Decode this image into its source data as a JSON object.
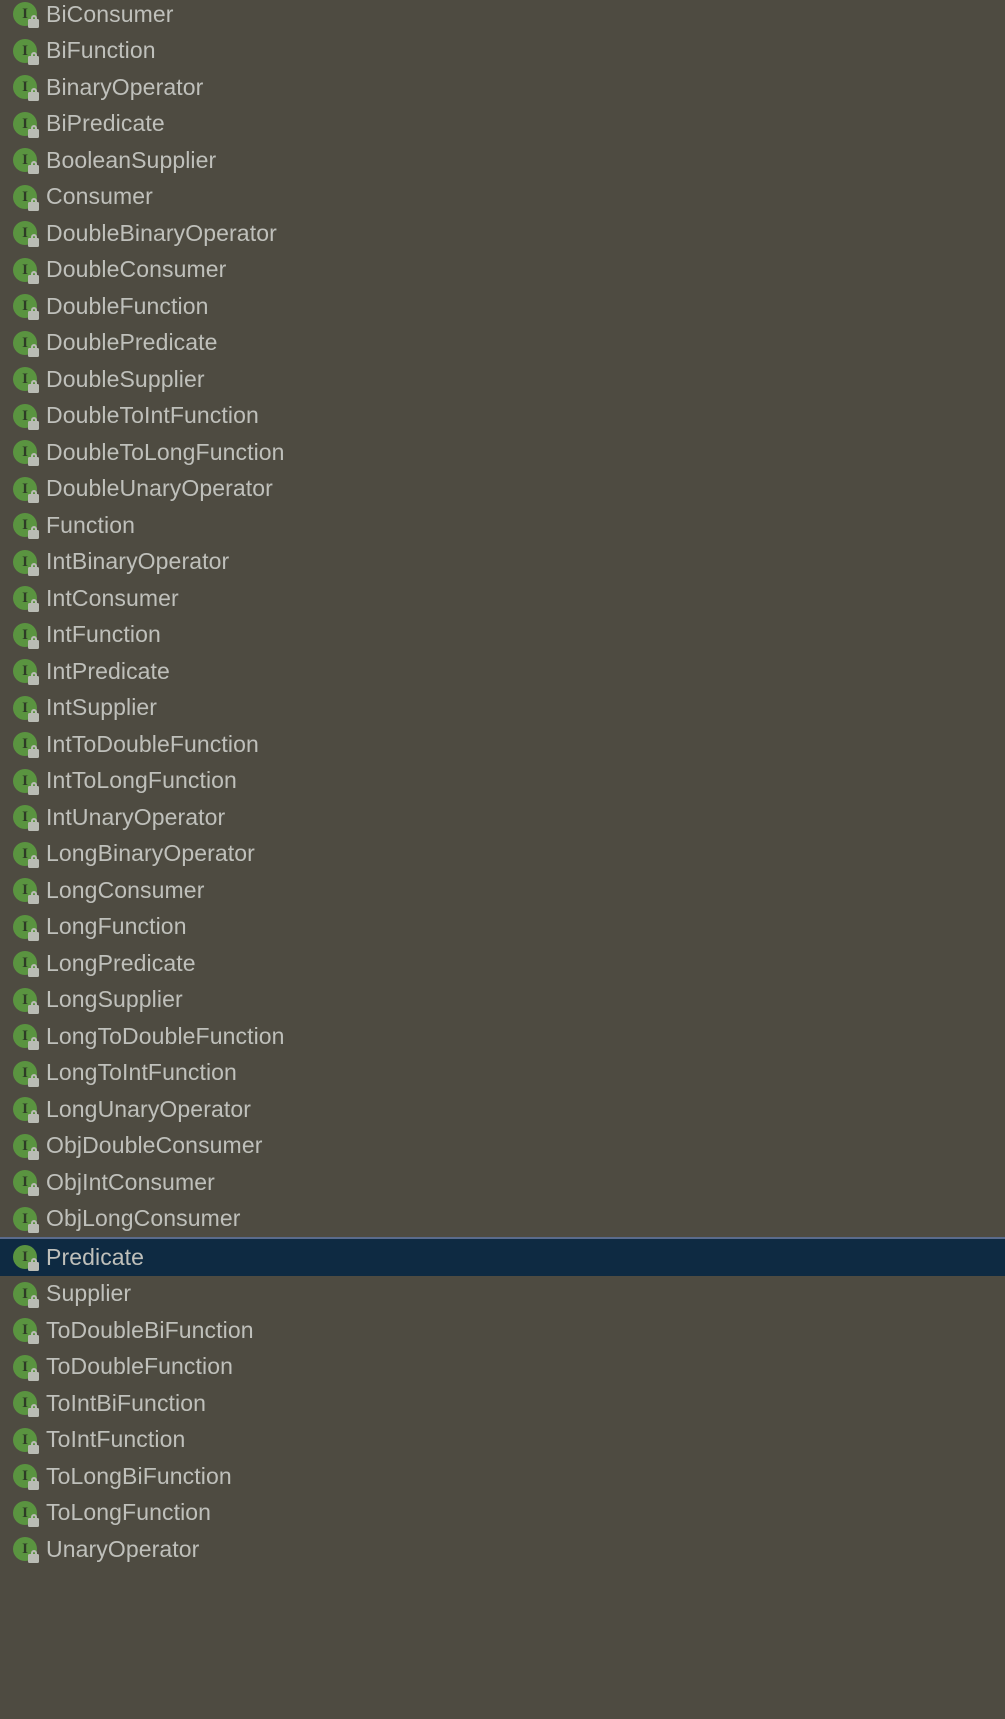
{
  "list": {
    "name": "java-util-function-interface-list",
    "background_color": "#4e4b41",
    "text_color": "#bfc0bb",
    "selection_background_color": "#0e2a42",
    "selection_border_color": "#5a6b8c",
    "icon": {
      "semantic_name": "interface-icon",
      "glyph": "I",
      "circle_color": "#5a9440",
      "glyph_color": "#2e3b26",
      "badge": "lock-icon",
      "badge_color": "#b9bcb4"
    },
    "selected_index": 41,
    "items": [
      {
        "label": "BiConsumer",
        "icon": "interface-icon",
        "selected": false
      },
      {
        "label": "BiFunction",
        "icon": "interface-icon",
        "selected": false
      },
      {
        "label": "BinaryOperator",
        "icon": "interface-icon",
        "selected": false
      },
      {
        "label": "BiPredicate",
        "icon": "interface-icon",
        "selected": false
      },
      {
        "label": "BooleanSupplier",
        "icon": "interface-icon",
        "selected": false
      },
      {
        "label": "Consumer",
        "icon": "interface-icon",
        "selected": false
      },
      {
        "label": "DoubleBinaryOperator",
        "icon": "interface-icon",
        "selected": false
      },
      {
        "label": "DoubleConsumer",
        "icon": "interface-icon",
        "selected": false
      },
      {
        "label": "DoubleFunction",
        "icon": "interface-icon",
        "selected": false
      },
      {
        "label": "DoublePredicate",
        "icon": "interface-icon",
        "selected": false
      },
      {
        "label": "DoubleSupplier",
        "icon": "interface-icon",
        "selected": false
      },
      {
        "label": "DoubleToIntFunction",
        "icon": "interface-icon",
        "selected": false
      },
      {
        "label": "DoubleToLongFunction",
        "icon": "interface-icon",
        "selected": false
      },
      {
        "label": "DoubleUnaryOperator",
        "icon": "interface-icon",
        "selected": false
      },
      {
        "label": "Function",
        "icon": "interface-icon",
        "selected": false
      },
      {
        "label": "IntBinaryOperator",
        "icon": "interface-icon",
        "selected": false
      },
      {
        "label": "IntConsumer",
        "icon": "interface-icon",
        "selected": false
      },
      {
        "label": "IntFunction",
        "icon": "interface-icon",
        "selected": false
      },
      {
        "label": "IntPredicate",
        "icon": "interface-icon",
        "selected": false
      },
      {
        "label": "IntSupplier",
        "icon": "interface-icon",
        "selected": false
      },
      {
        "label": "IntToDoubleFunction",
        "icon": "interface-icon",
        "selected": false
      },
      {
        "label": "IntToLongFunction",
        "icon": "interface-icon",
        "selected": false
      },
      {
        "label": "IntUnaryOperator",
        "icon": "interface-icon",
        "selected": false
      },
      {
        "label": "LongBinaryOperator",
        "icon": "interface-icon",
        "selected": false
      },
      {
        "label": "LongConsumer",
        "icon": "interface-icon",
        "selected": false
      },
      {
        "label": "LongFunction",
        "icon": "interface-icon",
        "selected": false
      },
      {
        "label": "LongPredicate",
        "icon": "interface-icon",
        "selected": false
      },
      {
        "label": "LongSupplier",
        "icon": "interface-icon",
        "selected": false
      },
      {
        "label": "LongToDoubleFunction",
        "icon": "interface-icon",
        "selected": false
      },
      {
        "label": "LongToIntFunction",
        "icon": "interface-icon",
        "selected": false
      },
      {
        "label": "LongUnaryOperator",
        "icon": "interface-icon",
        "selected": false
      },
      {
        "label": "ObjDoubleConsumer",
        "icon": "interface-icon",
        "selected": false
      },
      {
        "label": "ObjIntConsumer",
        "icon": "interface-icon",
        "selected": false
      },
      {
        "label": "ObjLongConsumer",
        "icon": "interface-icon",
        "selected": false
      },
      {
        "label": "Predicate",
        "icon": "interface-icon",
        "selected": true
      },
      {
        "label": "Supplier",
        "icon": "interface-icon",
        "selected": false
      },
      {
        "label": "ToDoubleBiFunction",
        "icon": "interface-icon",
        "selected": false
      },
      {
        "label": "ToDoubleFunction",
        "icon": "interface-icon",
        "selected": false
      },
      {
        "label": "ToIntBiFunction",
        "icon": "interface-icon",
        "selected": false
      },
      {
        "label": "ToIntFunction",
        "icon": "interface-icon",
        "selected": false
      },
      {
        "label": "ToLongBiFunction",
        "icon": "interface-icon",
        "selected": false
      },
      {
        "label": "ToLongFunction",
        "icon": "interface-icon",
        "selected": false
      },
      {
        "label": "UnaryOperator",
        "icon": "interface-icon",
        "selected": false
      }
    ]
  }
}
